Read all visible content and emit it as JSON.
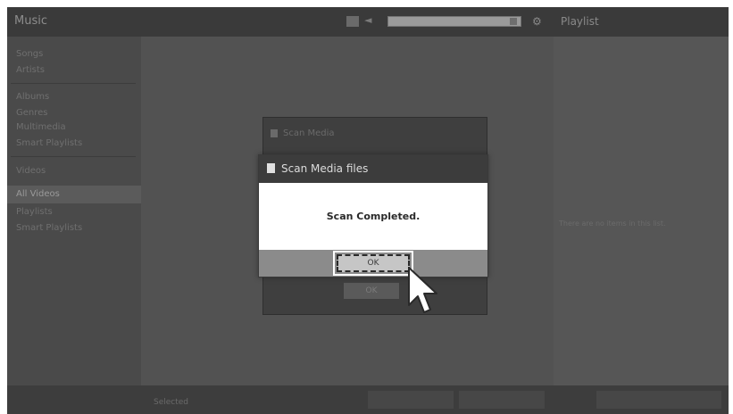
{
  "app": {
    "title": "Music"
  },
  "topbar": {
    "arrow_label": "◄",
    "settings_label": "⚙",
    "playlist_label": "Playlist"
  },
  "sidebar": {
    "items": [
      {
        "label": "Songs"
      },
      {
        "label": "Artists"
      },
      {
        "label": "Albums"
      },
      {
        "label": "Genres"
      },
      {
        "label": "Multimedia"
      },
      {
        "label": "Smart Playlists"
      },
      {
        "label": "Videos"
      },
      {
        "label": "All Videos"
      },
      {
        "label": "Playlists"
      },
      {
        "label": "Smart Playlists"
      }
    ]
  },
  "back_dialog": {
    "title": "Scan Media",
    "button_label": "OK"
  },
  "scan_dialog": {
    "title": "Scan Media files",
    "message": "Scan Completed.",
    "ok_label": "OK"
  },
  "right_panel": {
    "text": "There are no items in this list."
  },
  "bottombar": {
    "label": "Selected"
  }
}
